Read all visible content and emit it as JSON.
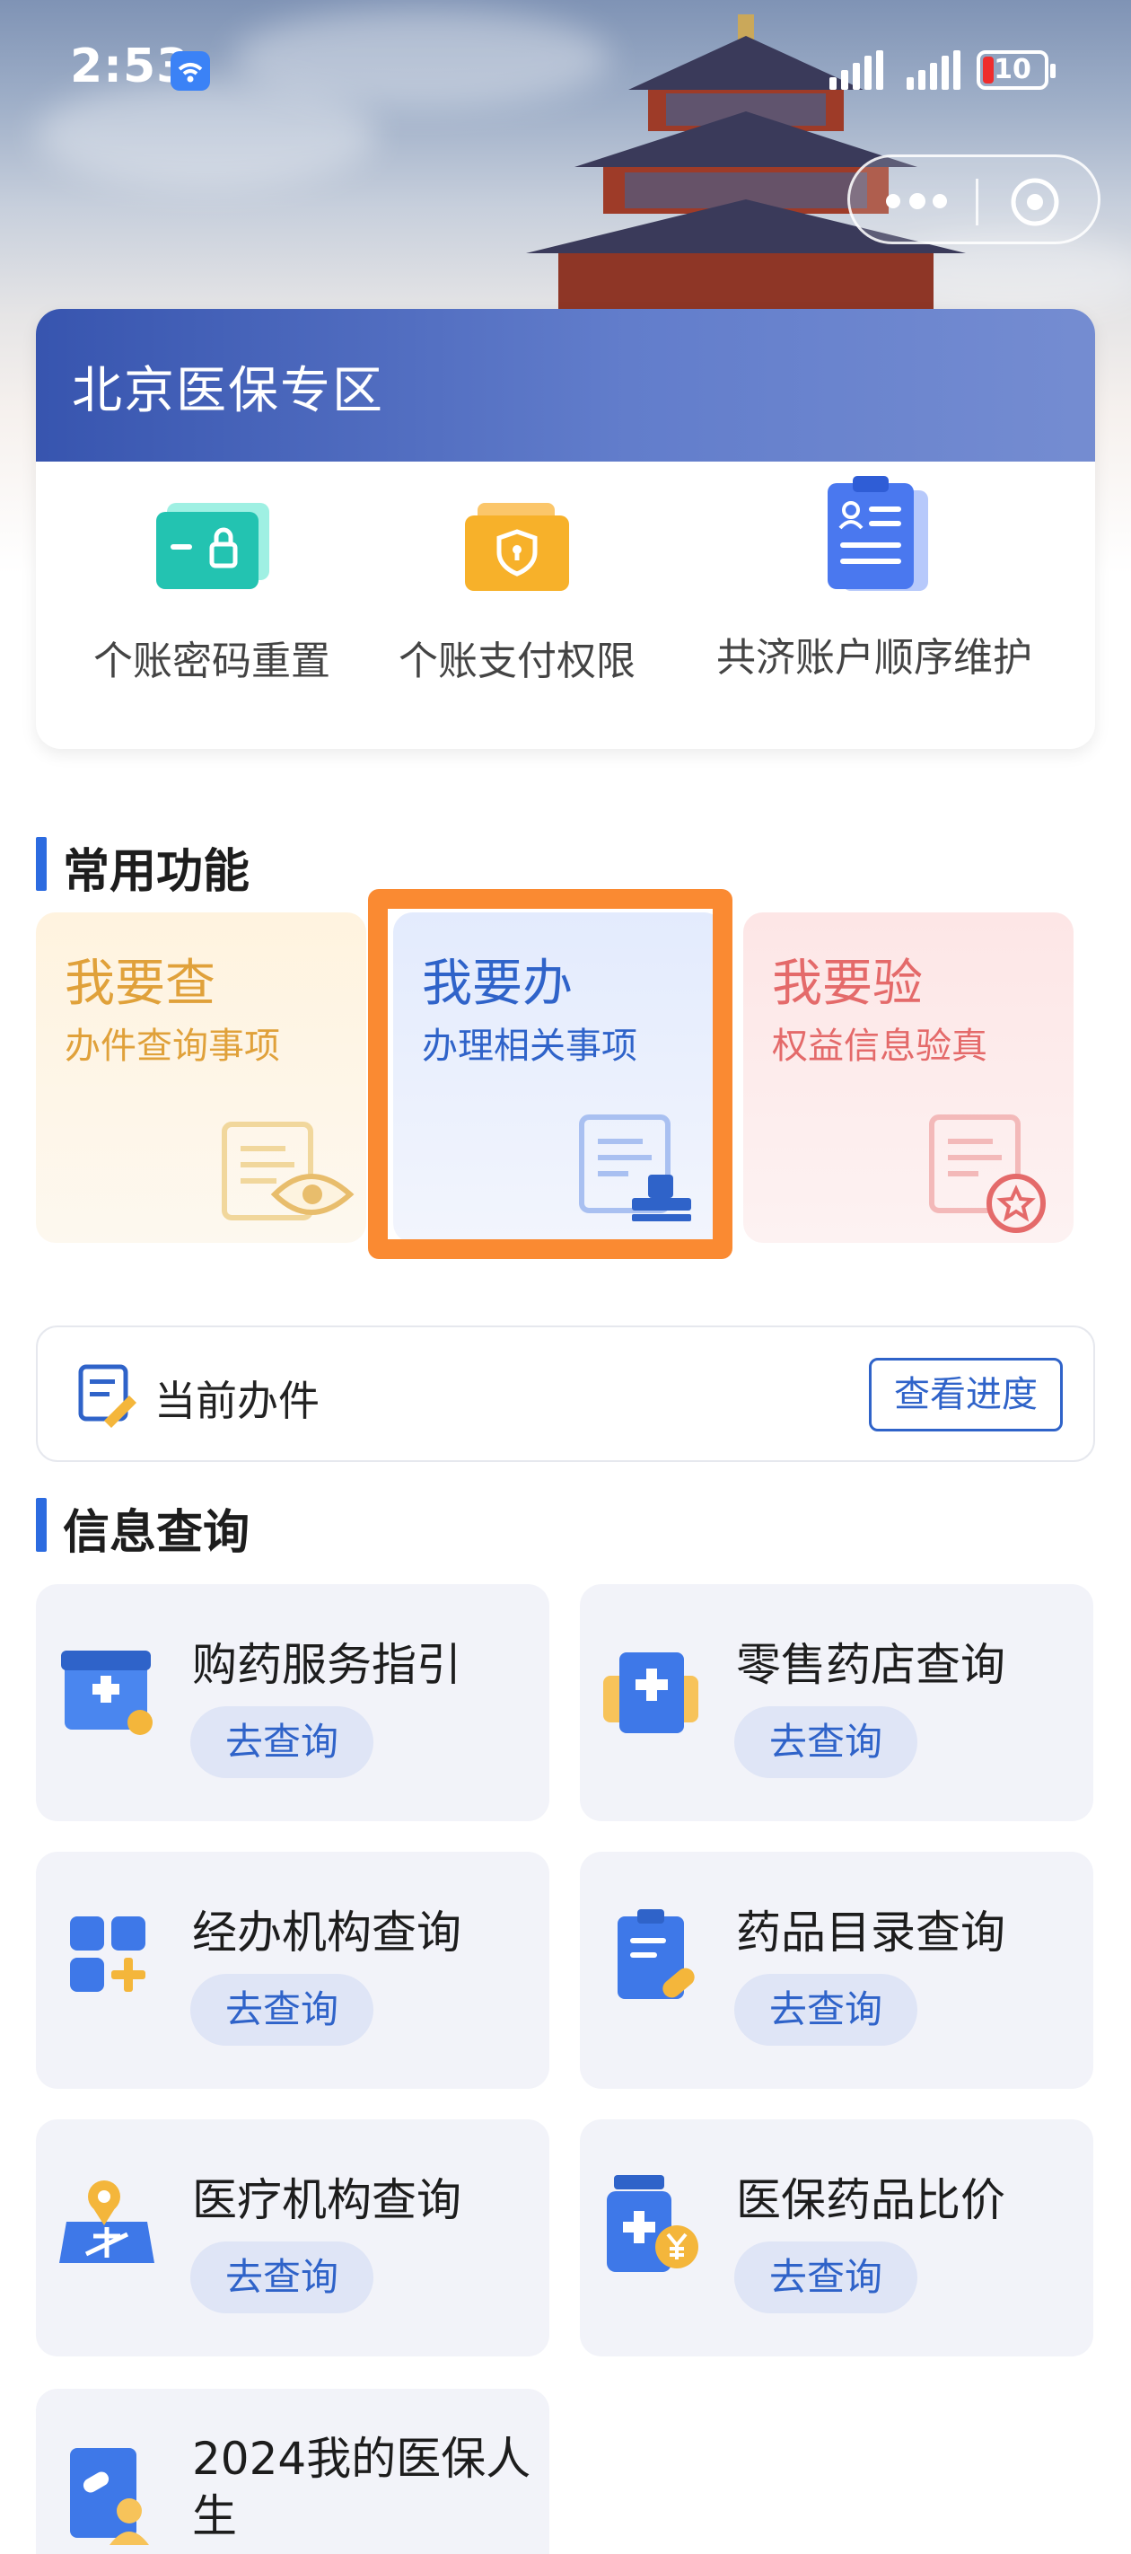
{
  "status_bar": {
    "time": "2:53",
    "battery": "10"
  },
  "beijing_zone": {
    "title": "北京医保专区",
    "items": [
      {
        "label": "个账密码重置",
        "icon": "card-lock-icon"
      },
      {
        "label": "个账支付权限",
        "icon": "wallet-shield-icon"
      },
      {
        "label": "共济账户顺序维护",
        "icon": "clipboard-user-icon"
      }
    ]
  },
  "common_functions": {
    "title": "常用功能",
    "tiles": [
      {
        "title": "我要查",
        "subtitle": "办件查询事项",
        "icon": "document-eye-icon"
      },
      {
        "title": "我要办",
        "subtitle": "办理相关事项",
        "icon": "document-stamp-icon"
      },
      {
        "title": "我要验",
        "subtitle": "权益信息验真",
        "icon": "document-badge-icon"
      }
    ]
  },
  "current_affair": {
    "label": "当前办件",
    "button": "查看进度"
  },
  "info_query": {
    "title": "信息查询",
    "cards": [
      {
        "title": "购药服务指引",
        "action": "去查询",
        "icon": "pharmacy-store-icon"
      },
      {
        "title": "零售药店查询",
        "action": "去查询",
        "icon": "medical-kit-icon"
      },
      {
        "title": "经办机构查询",
        "action": "去查询",
        "icon": "grid-plus-icon"
      },
      {
        "title": "药品目录查询",
        "action": "去查询",
        "icon": "clipboard-pill-icon"
      },
      {
        "title": "医疗机构查询",
        "action": "去查询",
        "icon": "map-pin-icon"
      },
      {
        "title": "医保药品比价",
        "action": "去查询",
        "icon": "pill-bottle-yen-icon"
      },
      {
        "title": "2024我的医保人生",
        "action": "",
        "icon": "user-report-icon"
      }
    ]
  },
  "colors": {
    "accent_blue": "#2f63c9",
    "highlight_orange": "#fa8a32",
    "gold": "#e0a13a",
    "rose": "#e46a6a"
  }
}
